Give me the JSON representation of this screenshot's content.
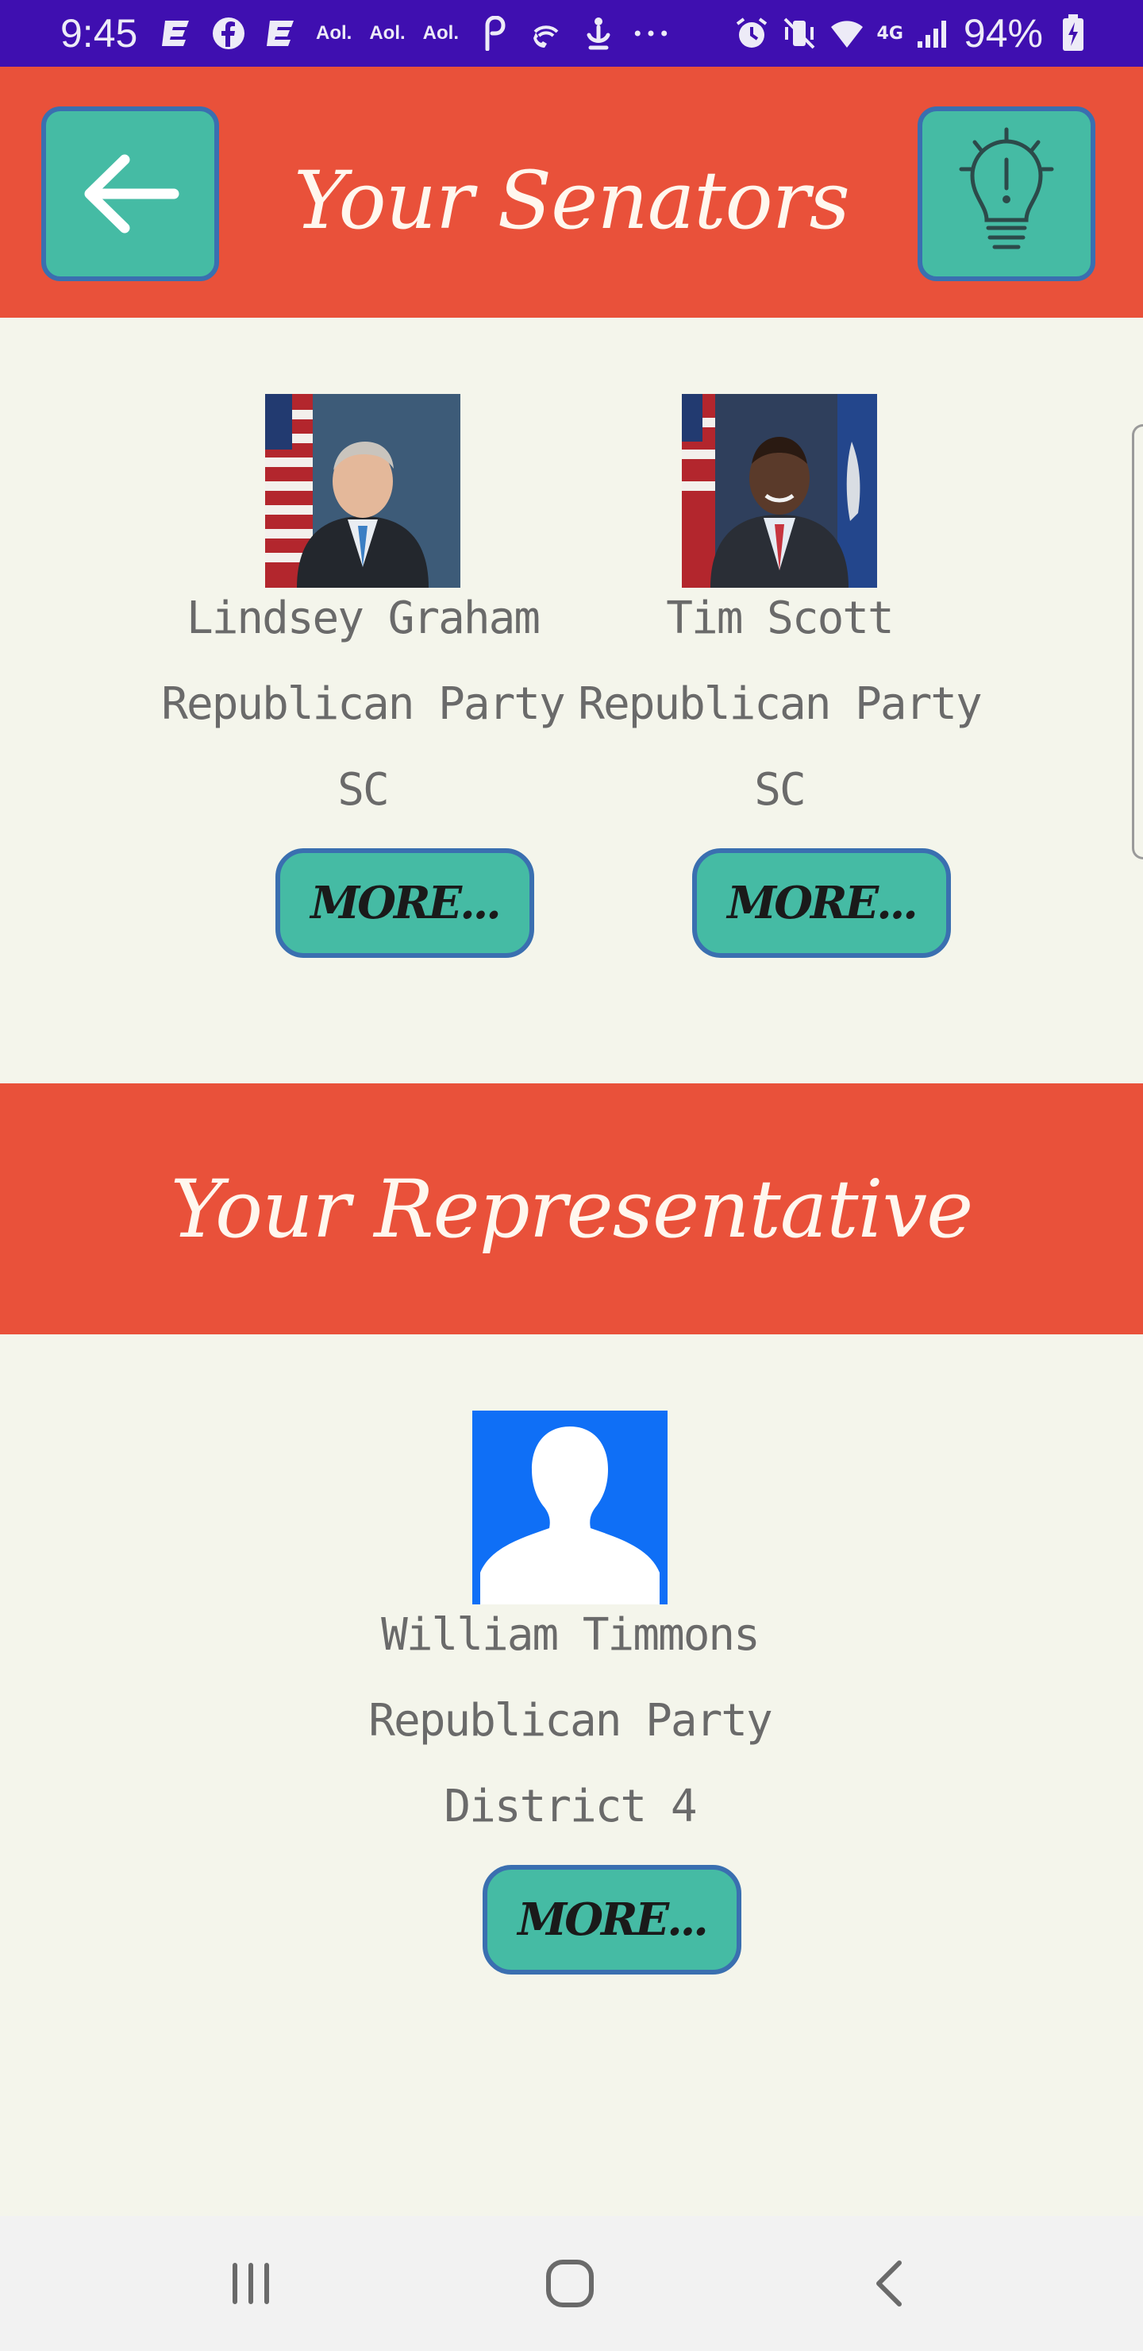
{
  "status_bar": {
    "time": "9:45",
    "left_icons": [
      "e-news-icon",
      "facebook-icon",
      "e-news-icon",
      "aol-icon",
      "aol-icon",
      "aol-icon",
      "pinterest-icon",
      "wifi-call-icon",
      "accessibility-icon",
      "more-dots-icon"
    ],
    "aol_label": "Aol.",
    "network_label": "4G",
    "battery_percent": "94%"
  },
  "header": {
    "title": "Your Senators"
  },
  "senators": [
    {
      "name": "Lindsey Graham",
      "party": "Republican Party",
      "state": "SC",
      "more_label": "MORE..."
    },
    {
      "name": "Tim Scott",
      "party": "Republican Party",
      "state": "SC",
      "more_label": "MORE..."
    }
  ],
  "representative_section": {
    "title": "Your Representative"
  },
  "representative": {
    "name": "William Timmons",
    "party": "Republican Party",
    "district": "District 4",
    "more_label": "MORE..."
  },
  "colors": {
    "status_bar": "#3F0FB0",
    "header_red": "#E9513A",
    "button_teal": "#45BBA4",
    "button_border": "#3A6FB0",
    "page_bg": "#F4F5EB",
    "text_gray": "#6A6A6A",
    "placeholder_blue": "#0F6FF6"
  }
}
